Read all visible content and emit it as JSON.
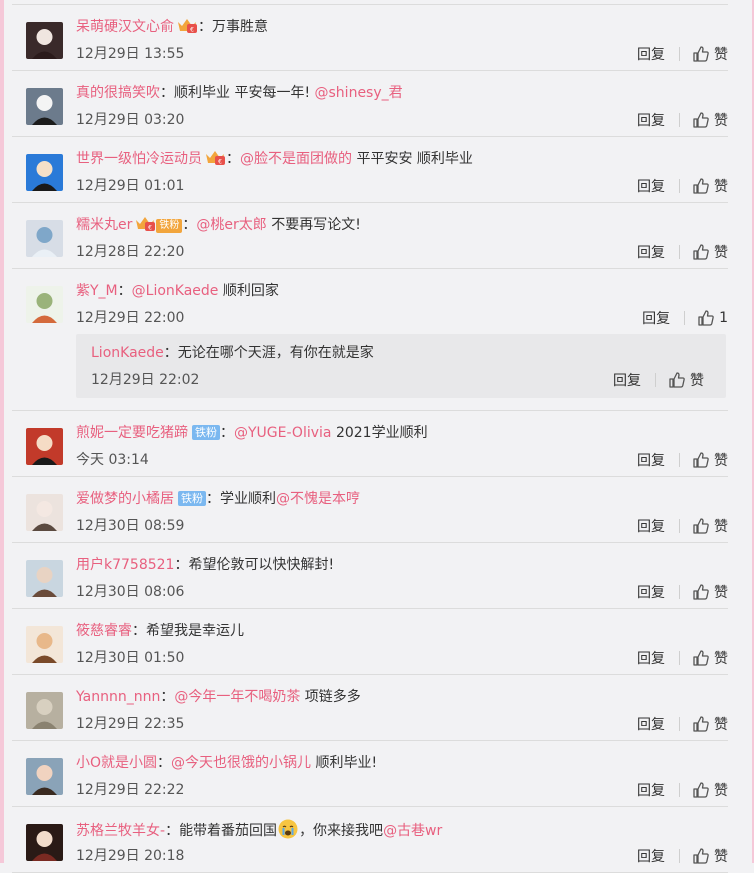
{
  "comments": [
    {
      "user": "呆萌硬汉文心俞",
      "badge_crown": true,
      "badge_fan": "",
      "parts": [
        {
          "t": "text",
          "v": "万事胜意"
        }
      ],
      "time": "12月29日 13:55",
      "reply": "回复",
      "like": "赞",
      "avatar": "a0"
    },
    {
      "user": "真的很搞笑吹",
      "badge_crown": false,
      "badge_fan": "",
      "parts": [
        {
          "t": "text",
          "v": "顺利毕业  平安每一年! "
        },
        {
          "t": "mention",
          "v": "@shinesy_君"
        }
      ],
      "time": "12月29日 03:20",
      "reply": "回复",
      "like": "赞",
      "avatar": "a1"
    },
    {
      "user": "世界一级怕冷运动员",
      "badge_crown": true,
      "badge_fan": "",
      "parts": [
        {
          "t": "mention",
          "v": "@脸不是面团做的"
        },
        {
          "t": "text",
          "v": "  平平安安 顺利毕业"
        }
      ],
      "time": "12月29日 01:01",
      "reply": "回复",
      "like": "赞",
      "avatar": "a2"
    },
    {
      "user": "糯米丸er",
      "badge_crown": true,
      "badge_fan_orange": "铁粉",
      "parts": [
        {
          "t": "mention",
          "v": "@桃er太郎"
        },
        {
          "t": "text",
          "v": " 不要再写论文!"
        }
      ],
      "time": "12月28日 22:20",
      "reply": "回复",
      "like": "赞",
      "avatar": "a3"
    },
    {
      "user": "紫Y_M",
      "badge_crown": false,
      "badge_fan": "",
      "parts": [
        {
          "t": "mention",
          "v": "@LionKaede"
        },
        {
          "t": "text",
          "v": " 顺利回家"
        }
      ],
      "time": "12月29日 22:00",
      "reply": "回复",
      "like": "1",
      "avatar": "a4",
      "sub": {
        "user": "LionKaede",
        "parts": [
          {
            "t": "text",
            "v": "无论在哪个天涯，有你在就是家"
          }
        ],
        "time": "12月29日 22:02",
        "reply": "回复",
        "like": "赞"
      }
    },
    {
      "user": "煎妮一定要吃猪蹄",
      "badge_crown": false,
      "badge_fan": "铁粉",
      "parts": [
        {
          "t": "mention",
          "v": "@YUGE-Olivia"
        },
        {
          "t": "text",
          "v": " 2021学业顺利"
        }
      ],
      "time": "今天 03:14",
      "reply": "回复",
      "like": "赞",
      "avatar": "a5"
    },
    {
      "user": "爱做梦的小橘居",
      "badge_crown": false,
      "badge_fan": "铁粉",
      "parts": [
        {
          "t": "text",
          "v": "学业顺利"
        },
        {
          "t": "mention",
          "v": "@不愧是本哼"
        }
      ],
      "time": "12月30日 08:59",
      "reply": "回复",
      "like": "赞",
      "avatar": "a6"
    },
    {
      "user": "用户k7758521",
      "badge_crown": false,
      "badge_fan": "",
      "parts": [
        {
          "t": "text",
          "v": "希望伦敦可以快快解封!"
        }
      ],
      "time": "12月30日 08:06",
      "reply": "回复",
      "like": "赞",
      "avatar": "a7"
    },
    {
      "user": "筱慈睿睿",
      "badge_crown": false,
      "badge_fan": "",
      "parts": [
        {
          "t": "text",
          "v": "希望我是幸运儿"
        }
      ],
      "time": "12月30日 01:50",
      "reply": "回复",
      "like": "赞",
      "avatar": "a8"
    },
    {
      "user": "Yannnn_nnn",
      "badge_crown": false,
      "badge_fan": "",
      "parts": [
        {
          "t": "mention",
          "v": "@今年一年不喝奶茶"
        },
        {
          "t": "text",
          "v": " 项链多多"
        }
      ],
      "time": "12月29日 22:35",
      "reply": "回复",
      "like": "赞",
      "avatar": "a9"
    },
    {
      "user": "小O就是小圆",
      "badge_crown": false,
      "badge_fan": "",
      "parts": [
        {
          "t": "mention",
          "v": "@今天也很饿的小锅儿"
        },
        {
          "t": "text",
          "v": " 顺利毕业!"
        }
      ],
      "time": "12月29日 22:22",
      "reply": "回复",
      "like": "赞",
      "avatar": "a10"
    },
    {
      "user": "苏格兰牧羊女-",
      "badge_crown": false,
      "badge_fan": "",
      "parts": [
        {
          "t": "text",
          "v": "能带着番茄回国"
        },
        {
          "t": "emoji",
          "v": "crying-emoji"
        },
        {
          "t": "text",
          "v": "，你来接我吧"
        },
        {
          "t": "mention",
          "v": "@古巷wr"
        }
      ],
      "time": "12月29日 20:18",
      "reply": "回复",
      "like": "赞",
      "avatar": "a11"
    }
  ],
  "colors": {
    "username": "#e8607f",
    "mention": "#e8607f",
    "fan_badge": "#7bb8f0",
    "fan_badge_orange": "#f2a53c",
    "background": "#f2f2f4"
  },
  "icons": {
    "like": "thumbs-up-icon",
    "crown_badge": "crown-badge-icon"
  }
}
